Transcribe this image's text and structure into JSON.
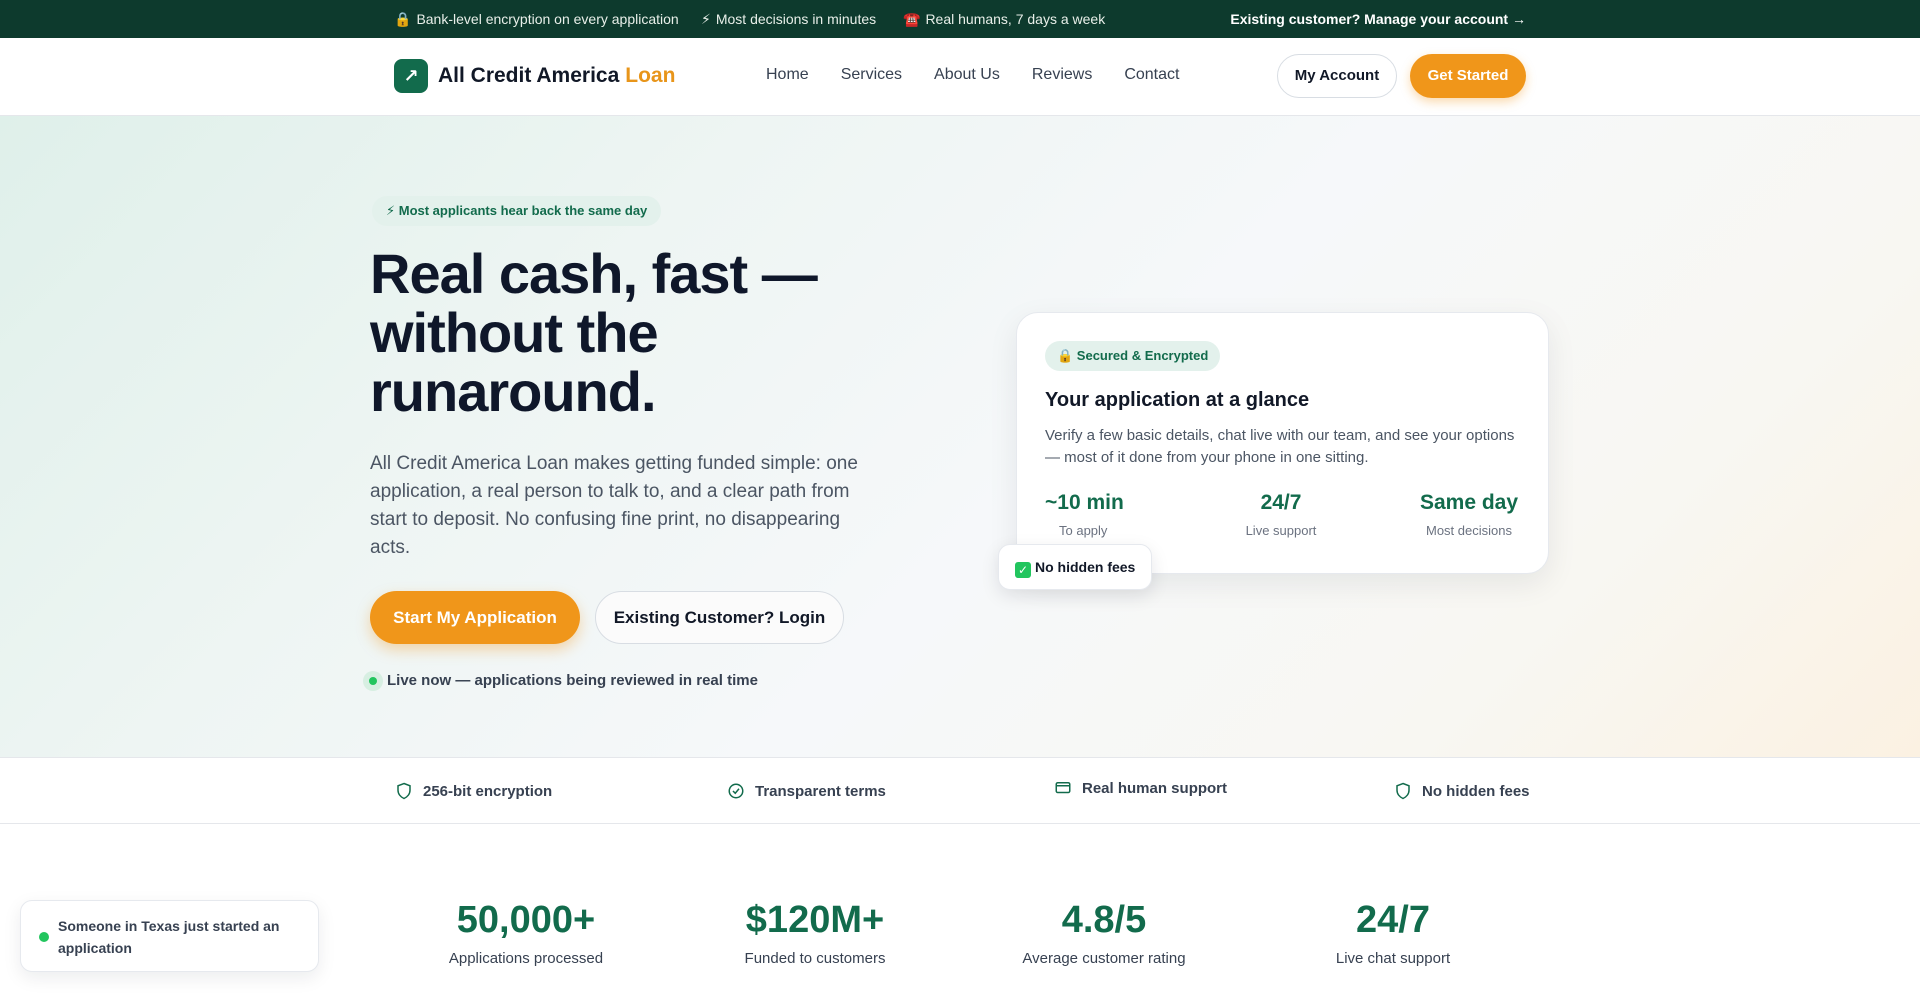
{
  "topbar": {
    "items": [
      {
        "glyph": "🔒",
        "text": "Bank-level encryption on every application"
      },
      {
        "glyph": "⚡",
        "text": "Most decisions in minutes"
      },
      {
        "glyph": "☎️",
        "text": "Real humans, 7 days a week"
      }
    ],
    "account_link": "Existing customer? Manage your account →"
  },
  "nav": {
    "logo_glyph": "↗",
    "brand_name": "All Credit America",
    "brand_accent": "Loan",
    "links": [
      "Home",
      "Services",
      "About Us",
      "Reviews",
      "Contact"
    ],
    "my_account": "My Account",
    "get_started": "Get Started"
  },
  "hero": {
    "pill": "⚡ Most applicants hear back the same day",
    "headline": "Real cash, fast — without the runaround.",
    "lead": "All Credit America Loan makes getting funded simple: one application, a real person to talk to, and a clear path from start to deposit. No confusing fine print, no disappearing acts.",
    "cta_primary": "Start My Application",
    "cta_secondary": "Existing Customer? Login",
    "live_text": "Live now — applications being reviewed in real time"
  },
  "card": {
    "badge": "🔒 Secured & Encrypted",
    "title": "Your application at a glance",
    "description": "Verify a few basic details, chat live with our team, and see your options — most of it done from your phone in one sitting.",
    "stats": [
      {
        "value": "~10 min",
        "label": "To apply"
      },
      {
        "value": "24/7",
        "label": "Live support"
      },
      {
        "value": "Same day",
        "label": "Most decisions"
      }
    ],
    "chip": "No hidden fees",
    "chip_glyph": "✓"
  },
  "trust": {
    "items": [
      {
        "icon": "shield-icon",
        "text": "256-bit encryption"
      },
      {
        "icon": "check-circle-icon",
        "text": "Transparent terms"
      },
      {
        "icon": "card-icon",
        "text": "Real human support"
      },
      {
        "icon": "shield-icon",
        "text": "No hidden fees"
      }
    ]
  },
  "stats": {
    "items": [
      {
        "value": "50,000+",
        "label": "Applications processed"
      },
      {
        "value": "$120M+",
        "label": "Funded to customers"
      },
      {
        "value": "4.8/5",
        "label": "Average customer rating"
      },
      {
        "value": "24/7",
        "label": "Live chat support"
      }
    ]
  },
  "toast": {
    "text": "Someone in Texas just started an application"
  },
  "colors": {
    "brand_green": "#126b4c",
    "dark_green": "#0d3a2d",
    "accent_orange": "#f0961a"
  }
}
